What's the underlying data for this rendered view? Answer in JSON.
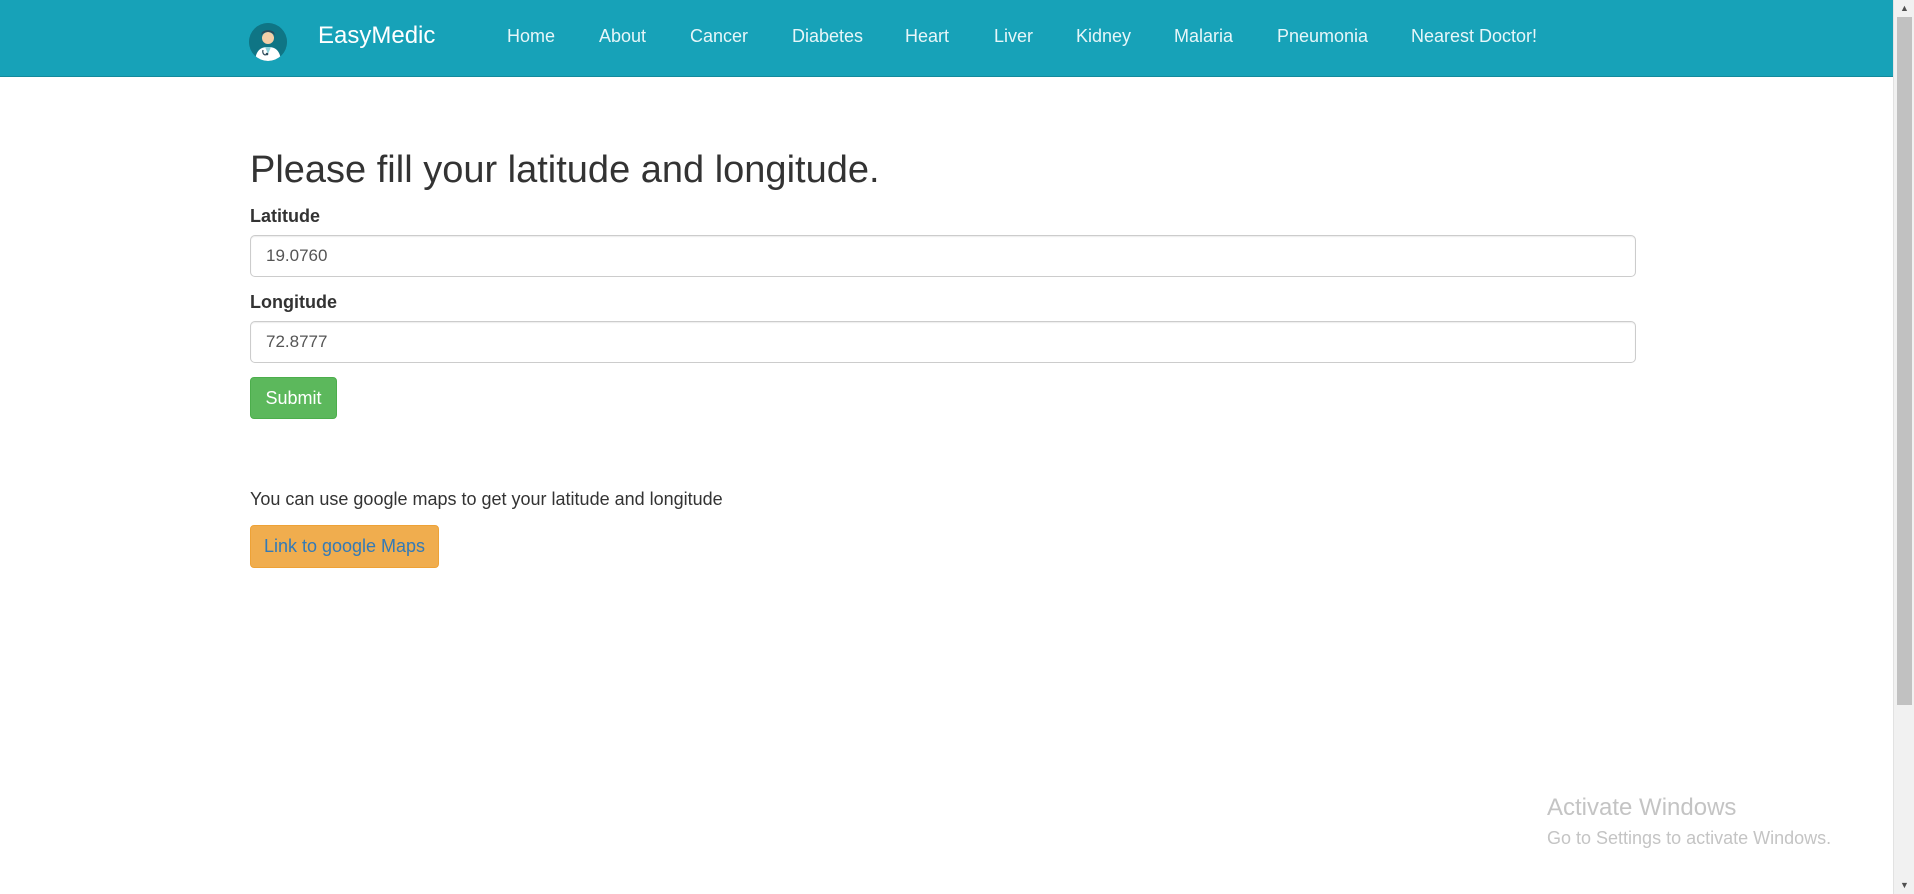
{
  "navbar": {
    "brand": "EasyMedic",
    "brand_icon": "doctor-avatar-icon",
    "links": [
      "Home",
      "About",
      "Cancer",
      "Diabetes",
      "Heart",
      "Liver",
      "Kidney",
      "Malaria",
      "Pneumonia",
      "Nearest Doctor!"
    ],
    "background_color": "#17a2b8"
  },
  "form": {
    "heading": "Please fill your latitude and longitude.",
    "latitude_label": "Latitude",
    "latitude_value": "19.0760",
    "longitude_label": "Longitude",
    "longitude_value": "72.8777",
    "submit_label": "Submit",
    "submit_color": "#5cb85c"
  },
  "maps": {
    "helper_text": "You can use google maps to get your latitude and longitude",
    "button_label": "Link to google Maps",
    "button_color": "#f0ad4e"
  },
  "watermark": {
    "title": "Activate Windows",
    "subtitle": "Go to Settings to activate Windows."
  }
}
